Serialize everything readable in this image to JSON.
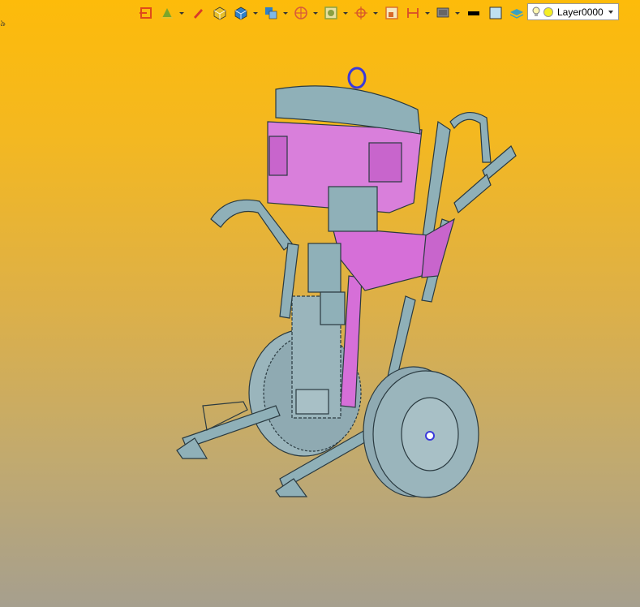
{
  "window": {
    "corner_label": "৯"
  },
  "toolbar": {
    "items": [
      {
        "name": "exit-icon",
        "color": "#E04A1A",
        "dropdown": false
      },
      {
        "name": "layer-tool-icon",
        "color": "#7CA62A",
        "dropdown": true
      },
      {
        "name": "pen-icon",
        "color": "#D83A2A",
        "dropdown": false
      },
      {
        "name": "cube-yellow-icon",
        "color": "#E8C02A",
        "dropdown": false
      },
      {
        "name": "cube-blue-icon",
        "color": "#2E7FC8",
        "dropdown": true
      },
      {
        "name": "views-icon",
        "color": "#2E7FC8",
        "dropdown": true
      },
      {
        "name": "section-icon",
        "color": "#D85A3A",
        "dropdown": true
      },
      {
        "name": "render-icon",
        "color": "#8AA040",
        "dropdown": true
      },
      {
        "name": "snap-icon",
        "color": "#D85A2A",
        "dropdown": true
      },
      {
        "name": "frame-icon",
        "color": "#D86A2A",
        "dropdown": false
      },
      {
        "name": "align-icon",
        "color": "#D84A2A",
        "dropdown": true
      },
      {
        "name": "display-icon",
        "color": "#666666",
        "dropdown": true
      },
      {
        "name": "line-color-icon",
        "color": "#000000",
        "dropdown": false
      },
      {
        "name": "fill-color-icon",
        "color": "#BFE0F0",
        "dropdown": false
      },
      {
        "name": "layers-icon",
        "color": "#3AA0C0",
        "dropdown": true
      }
    ]
  },
  "layer_select": {
    "value": "Layer0000"
  },
  "model": {
    "name": "paint-sprayer-cart",
    "body_color": "#8FB0B8",
    "highlight_color": "#D66FD8"
  }
}
